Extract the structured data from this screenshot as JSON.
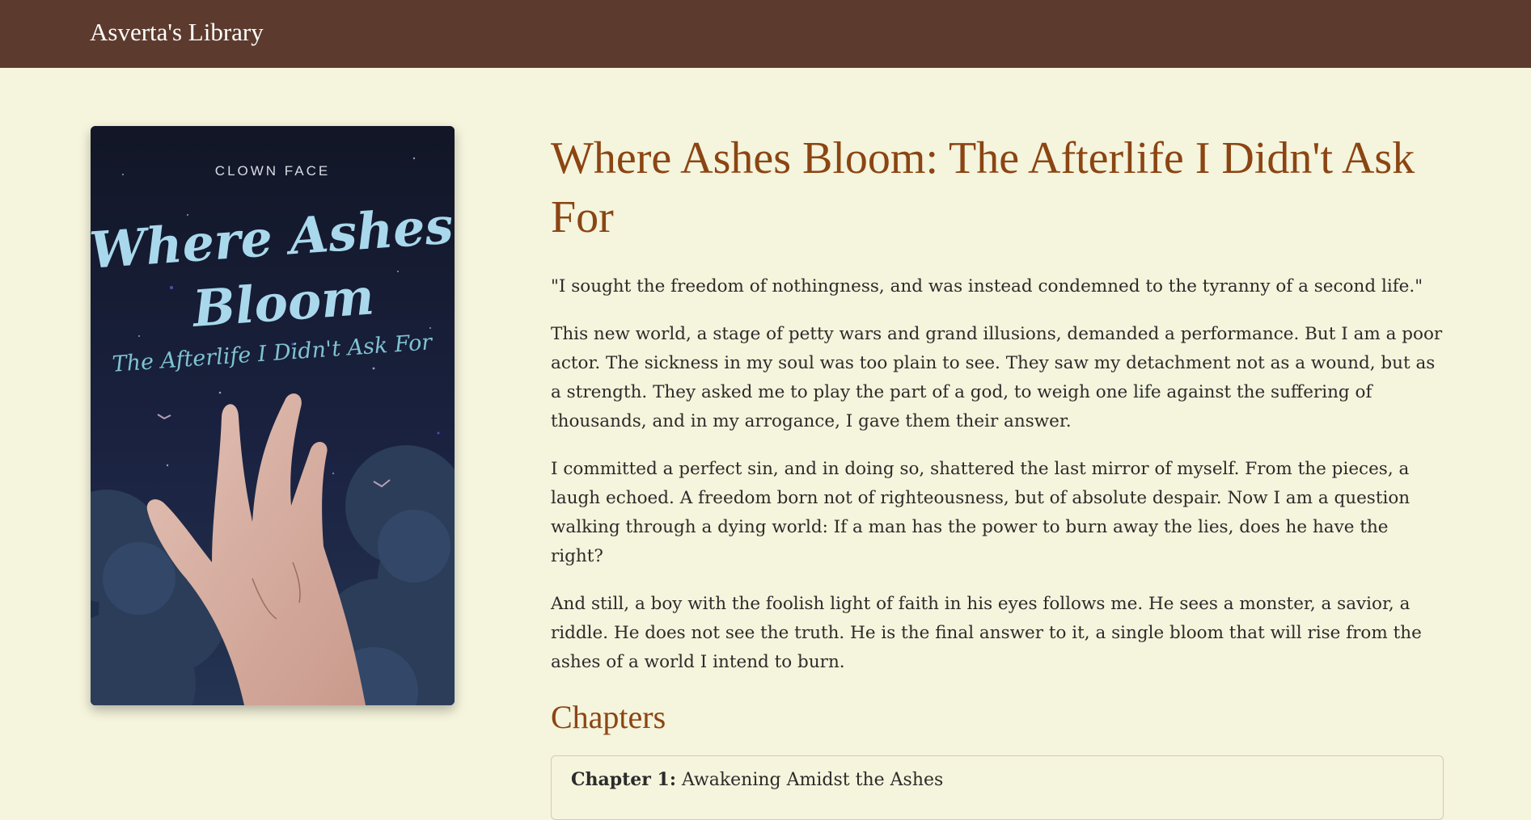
{
  "header": {
    "brand": "Asverta's Library"
  },
  "book": {
    "cover": {
      "author": "CLOWN FACE",
      "title_line1": "Where Ashes",
      "title_line2": "Bloom",
      "subtitle": "The Afterlife I Didn't Ask For"
    },
    "title": "Where Ashes Bloom: The Afterlife I Didn't Ask For",
    "tagline": "\"I sought the freedom of nothingness, and was instead condemned to the tyranny of a second life.\"",
    "description": [
      "This new world, a stage of petty wars and grand illusions, demanded a performance. But I am a poor actor. The sickness in my soul was too plain to see. They saw my detachment not as a wound, but as a strength. They asked me to play the part of a god, to weigh one life against the suffering of thousands, and in my arrogance, I gave them their answer.",
      "I committed a perfect sin, and in doing so, shattered the last mirror of myself. From the pieces, a laugh echoed. A freedom born not of righteousness, but of absolute despair. Now I am a question walking through a dying world: If a man has the power to burn away the lies, does he have the right?",
      "And still, a boy with the foolish light of faith in his eyes follows me. He sees a monster, a savior, a riddle. He does not see the truth. He is the final answer to it, a single bloom that will rise from the ashes of a world I intend to burn."
    ]
  },
  "chapters": {
    "heading": "Chapters",
    "items": [
      {
        "number": "Chapter 1:",
        "title": "Awakening Amidst the Ashes"
      }
    ]
  },
  "colors": {
    "navbar": "#5c3b2e",
    "background": "#f5f4dc",
    "accent": "#8b4513",
    "text": "#2b2b2b"
  }
}
